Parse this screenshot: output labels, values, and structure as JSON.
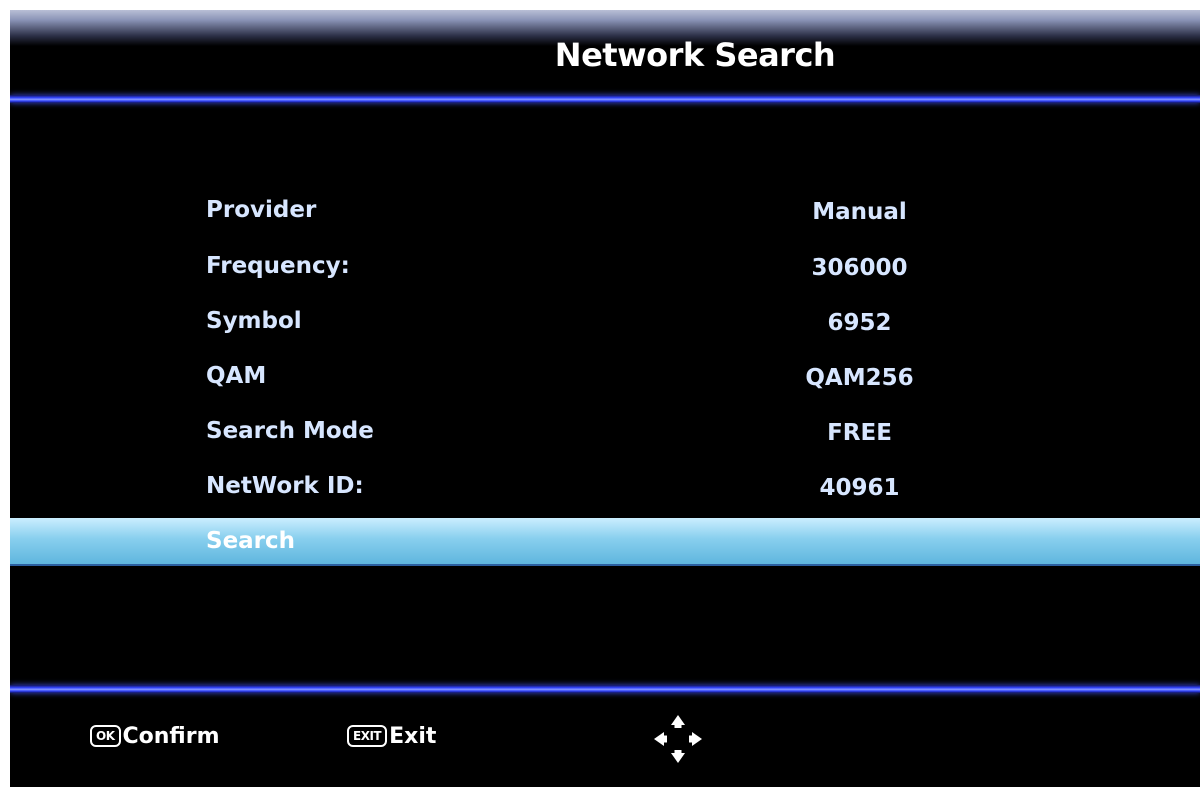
{
  "header": {
    "title": "Network Search"
  },
  "menu": {
    "items": [
      {
        "label": "Provider",
        "value": "Manual"
      },
      {
        "label": "Frequency:",
        "value": "306000"
      },
      {
        "label": "Symbol",
        "value": "6952"
      },
      {
        "label": "QAM",
        "value": "QAM256"
      },
      {
        "label": "Search Mode",
        "value": "FREE"
      },
      {
        "label": "NetWork ID:",
        "value": "40961"
      }
    ],
    "search_label": "Search"
  },
  "footer": {
    "confirm_key": "OK",
    "confirm_label": "Confirm",
    "exit_key": "EXIT",
    "exit_label": "Exit",
    "nav_icon": "four-way-arrows-icon"
  },
  "colors": {
    "background": "#000000",
    "rule_blue": "#3346ff",
    "highlight": "#88cfee",
    "text": "#d7e6ff"
  }
}
